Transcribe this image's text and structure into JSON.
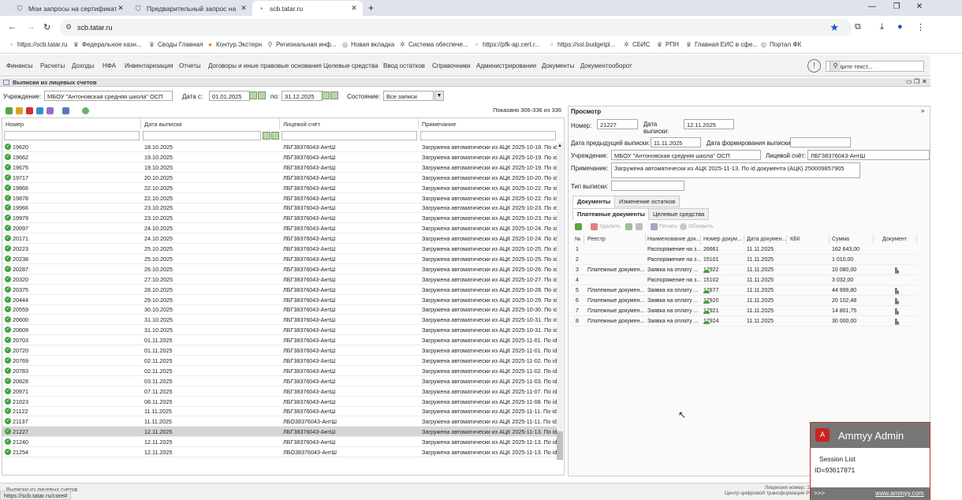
{
  "browser": {
    "tabs": [
      {
        "title": "Мои запросы на сертификат"
      },
      {
        "title": "Предварительный запрос на"
      },
      {
        "title": "scb.tatar.ru"
      }
    ],
    "url": "scb.tatar.ru",
    "bookmarks": [
      "https://scb.tatar.ru",
      "Федеральное казн...",
      "Своды Главная",
      "Контур.Экстерн",
      "Региональная инф...",
      "Новая вкладка",
      "Система обеспече...",
      "https://pfk-ap.cert.r...",
      "https://ssl.budgetpl...",
      "СБИС",
      "РПН",
      "Главная ЕИС в сфе...",
      "Портал ФК"
    ]
  },
  "menu": [
    "Финансы",
    "Расчеты",
    "Доходы",
    "НФА",
    "Инвентаризация",
    "Отчеты",
    "Договоры и иные правовые основания",
    "Целевые средства",
    "Ввод остатков",
    "Справочники",
    "Администрирование",
    "Документы",
    "Документооборот"
  ],
  "search_placeholder": "Введите текст...",
  "panel_title": "Выписки из лицевых счетов",
  "filters": {
    "inst_label": "Учреждение:",
    "inst_value": "МБОУ \"Антоновская средняя школа\" ОСП",
    "date_from_label": "Дата с:",
    "date_from": "01.01.2025",
    "date_to_label": "по:",
    "date_to": "31.12.2025",
    "state_label": "Состояние:",
    "state_value": "Все записи"
  },
  "shown_text": "Показано 306-336 из 336",
  "grid": {
    "headers": [
      "Номер",
      "Дата выписки",
      "Лицевой счёт",
      "Примечание"
    ],
    "rows": [
      [
        "19620",
        "18.10.2025",
        "ЛБГ38376043-АнтШ",
        "Загружена автоматически из АЦК 2025-10-18. По id"
      ],
      [
        "19662",
        "19.10.2025",
        "ЛБГ38376043-АнтШ",
        "Загружена автоматически из АЦК 2025-10-19. По id"
      ],
      [
        "19675",
        "19.10.2025",
        "ЛБГ38376043-АнтШ",
        "Загружена автоматически из АЦК 2025-10-19. По id"
      ],
      [
        "19717",
        "20.10.2025",
        "ЛБГ38376043-АнтШ",
        "Загружена автоматически из АЦК 2025-10-20. По id"
      ],
      [
        "19866",
        "22.10.2025",
        "ЛБГ38376043-АнтШ",
        "Загружена автоматически из АЦК 2025-10-22. По id"
      ],
      [
        "19878",
        "22.10.2025",
        "ЛБГ38376043-АнтШ",
        "Загружена автоматически из АЦК 2025-10-22. По id"
      ],
      [
        "19966",
        "23.10.2025",
        "ЛБГ38376043-АнтШ",
        "Загружена автоматически из АЦК 2025-10-23. По id"
      ],
      [
        "19979",
        "23.10.2025",
        "ЛБГ38376043-АнтШ",
        "Загружена автоматически из АЦК 2025-10-23. По id"
      ],
      [
        "20097",
        "24.10.2025",
        "ЛБГ38376043-АнтШ",
        "Загружена автоматически из АЦК 2025-10-24. По id"
      ],
      [
        "20171",
        "24.10.2025",
        "ЛБГ38376043-АнтШ",
        "Загружена автоматически из АЦК 2025-10-24. По id"
      ],
      [
        "20223",
        "25.10.2025",
        "ЛБГ38376043-АнтШ",
        "Загружена автоматически из АЦК 2025-10-25. По id"
      ],
      [
        "20238",
        "25.10.2025",
        "ЛБГ38376043-АнтШ",
        "Загружена автоматически из АЦК 2025-10-25. По id"
      ],
      [
        "20287",
        "26.10.2025",
        "ЛБГ38376043-АнтШ",
        "Загружена автоматически из АЦК 2025-10-26. По id"
      ],
      [
        "20320",
        "27.10.2025",
        "ЛБГ38376043-АнтШ",
        "Загружена автоматически из АЦК 2025-10-27. По id"
      ],
      [
        "20375",
        "28.10.2025",
        "ЛБГ38376043-АнтШ",
        "Загружена автоматически из АЦК 2025-10-28. По id"
      ],
      [
        "20444",
        "29.10.2025",
        "ЛБГ38376043-АнтШ",
        "Загружена автоматически из АЦК 2025-10-29. По id"
      ],
      [
        "20559",
        "30.10.2025",
        "ЛБГ38376043-АнтШ",
        "Загружена автоматически из АЦК 2025-10-30. По id"
      ],
      [
        "20600",
        "31.10.2025",
        "ЛБГ38376043-АнтШ",
        "Загружена автоматически из АЦК 2025-10-31. По id"
      ],
      [
        "20609",
        "31.10.2025",
        "ЛБГ38376043-АнтШ",
        "Загружена автоматически из АЦК 2025-10-31. По id"
      ],
      [
        "20703",
        "01.11.2025",
        "ЛБГ38376043-АнтШ",
        "Загружена автоматически из АЦК 2025-11-01. По id"
      ],
      [
        "20720",
        "01.11.2025",
        "ЛБГ38376043-АнтШ",
        "Загружена автоматически из АЦК 2025-11-01. По id"
      ],
      [
        "20769",
        "02.11.2025",
        "ЛБГ38376043-АнтШ",
        "Загружена автоматически из АЦК 2025-11-02. По id"
      ],
      [
        "20783",
        "02.11.2025",
        "ЛБГ38376043-АнтШ",
        "Загружена автоматически из АЦК 2025-11-02. По id"
      ],
      [
        "20828",
        "03.11.2025",
        "ЛБГ38376043-АнтШ",
        "Загружена автоматически из АЦК 2025-11-03. По id"
      ],
      [
        "20971",
        "07.11.2025",
        "ЛБГ38376043-АнтШ",
        "Загружена автоматически из АЦК 2025-11-07. По id"
      ],
      [
        "21023",
        "08.11.2025",
        "ЛБГ38376043-АнтШ",
        "Загружена автоматически из АЦК 2025-11-08. По id"
      ],
      [
        "21122",
        "11.11.2025",
        "ЛБГ38376043-АнтШ",
        "Загружена автоматически из АЦК 2025-11-11. По id"
      ],
      [
        "21137",
        "11.11.2025",
        "ЛБО38376043-АнтШ",
        "Загружена автоматически из АЦК 2025-11-11. По id"
      ],
      [
        "21227",
        "12.11.2025",
        "ЛБГ38376043-АнтШ",
        "Загружена автоматически из АЦК 2025-11-13. По id"
      ],
      [
        "21240",
        "12.11.2025",
        "ЛБГ38376043-АнтШ",
        "Загружена автоматически из АЦК 2025-11-13. По id"
      ],
      [
        "21254",
        "12.11.2025",
        "ЛБО38376043-АнтШ",
        "Загружена автоматически из АЦК 2025-11-13. По id"
      ]
    ]
  },
  "view": {
    "title": "Просмотр",
    "num_label": "Номер:",
    "num": "21227",
    "date_label1": "Дата",
    "date_label2": "выписки:",
    "date": "12.11.2025",
    "prev_label": "Дата предыдущей выписки:",
    "prev": "11.11.2025",
    "formed_label": "Дата формирования выписки:",
    "inst_label": "Учреждение:",
    "inst": "МБОУ \"Антоновская средняя школа\" ОСП",
    "acc_label": "Лицевой счёт:",
    "acc": "ЛБГ38376043-АнтШ",
    "note_label": "Примечание:",
    "note": "Загружена автоматически из АЦК 2025-11-13. По id документа (АЦК) 250009857905",
    "type_label": "Тип выписки:",
    "tabs": [
      "Документы",
      "Изменение остатков"
    ],
    "subtabs": [
      "Платежные документы",
      "Целевые средства"
    ],
    "btn_delete": "Удалить",
    "btn_print": "Печать",
    "btn_refresh": "Обновить",
    "dheaders": [
      "№",
      "Реестр",
      "Наименование док...",
      "Номер докум...",
      "Дата докумен...",
      "КБК",
      "Сумма",
      "Документ"
    ],
    "drows": [
      [
        "1",
        "",
        "Распоряжение на з...",
        "26661",
        "11.11.2025",
        "",
        "162 643,00",
        false,
        false
      ],
      [
        "2",
        "",
        "Распоряжение на з...",
        "15101",
        "11.11.2025",
        "",
        "1 010,00",
        false,
        false
      ],
      [
        "3",
        "Платежные докумен...",
        "Заявка на оплату ...",
        "17922",
        "11.11.2025",
        "",
        "10 080,00",
        true,
        true
      ],
      [
        "4",
        "",
        "Распоряжение на з...",
        "15102",
        "11.11.2025",
        "",
        "3 032,00",
        false,
        false
      ],
      [
        "5",
        "Платежные докумен...",
        "Заявка на оплату ...",
        "17877",
        "11.11.2025",
        "",
        "44 999,80",
        true,
        true
      ],
      [
        "6",
        "Платежные докумен...",
        "Заявка на оплату ...",
        "17920",
        "11.11.2025",
        "",
        "20 102,48",
        true,
        true
      ],
      [
        "7",
        "Платежные докумен...",
        "Заявка на оплату ...",
        "17921",
        "11.11.2025",
        "",
        "14 801,75",
        true,
        true
      ],
      [
        "8",
        "Платежные докумен...",
        "Заявка на оплату ...",
        "17924",
        "11.11.2025",
        "",
        "30 000,00",
        true,
        true
      ]
    ]
  },
  "status": {
    "url": "https://scb.tatar.ru/core#",
    "license": "Лицензия номер: 1",
    "center": "Центр цифровой трансформации Рес",
    "bottom_tab": "Выписки из лицевых счетов"
  },
  "ammyy": {
    "title": "Ammyy Admin",
    "session": "Session List",
    "id": "ID=93617871",
    "arrows": ">>>",
    "site": "www.ammyy.com"
  }
}
